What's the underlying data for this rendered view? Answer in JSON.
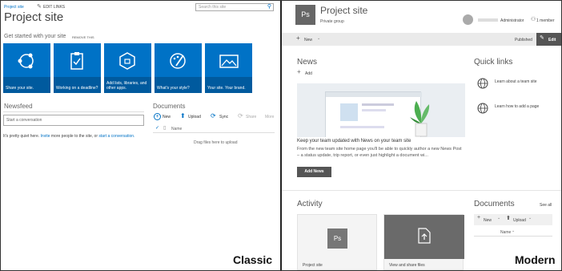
{
  "classic": {
    "breadcrumb": "Project site",
    "edit_links": "EDIT LINKS",
    "search_placeholder": "Search this site",
    "title": "Project site",
    "get_started": "Get started with your site",
    "remove_this": "REMOVE THIS",
    "tiles": [
      "Share your site.",
      "Working on a deadline?",
      "Add lists, libraries, and other apps.",
      "What's your style?",
      "Your site. Your brand."
    ],
    "newsfeed": "Newsfeed",
    "start_conversation": "Start a conversation",
    "quiet_text_1": "It's pretty quiet here.",
    "quiet_invite": "Invite",
    "quiet_text_2": "more people to the site, or",
    "quiet_start": "start a conversation.",
    "documents": "Documents",
    "doc_actions": {
      "new": "New",
      "upload": "Upload",
      "sync": "Sync",
      "share": "Share",
      "more": "More"
    },
    "name_col": "Name",
    "drag_text": "Drag files here to upload",
    "tag": "Classic"
  },
  "modern": {
    "logo": "Ps",
    "title": "Project site",
    "subtitle": "Private group",
    "admin": "Administrator",
    "members": "1 member",
    "new_btn": "New",
    "published": "Published",
    "edit": "Edit",
    "news": "News",
    "add": "Add",
    "news_heading": "Keep your team updated with News on your team site",
    "news_body": "From the new team site home page you'll be able to quickly author a new News Post – a status update, trip report, or even just highlight a document wi...",
    "add_news": "Add News",
    "quick_links": "Quick links",
    "ql_items": [
      "Learn about a team site",
      "Learn how to add a page"
    ],
    "activity": "Activity",
    "activity_cards": [
      "Project site",
      "View and share files"
    ],
    "documents": "Documents",
    "see_all": "See all",
    "doc_new": "New",
    "doc_upload": "Upload",
    "name_col": "Name",
    "tag": "Modern"
  },
  "colors": {
    "classic_blue": "#0072c6",
    "tile_strip": "#005a9e",
    "edit_btn": "#555555"
  }
}
